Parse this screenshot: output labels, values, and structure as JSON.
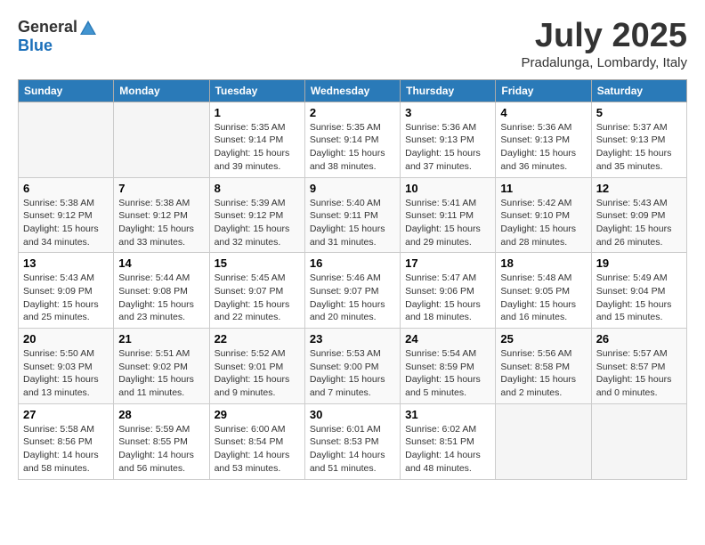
{
  "header": {
    "logo_general": "General",
    "logo_blue": "Blue",
    "month_title": "July 2025",
    "location": "Pradalunga, Lombardy, Italy"
  },
  "days_of_week": [
    "Sunday",
    "Monday",
    "Tuesday",
    "Wednesday",
    "Thursday",
    "Friday",
    "Saturday"
  ],
  "weeks": [
    [
      {
        "num": "",
        "info": ""
      },
      {
        "num": "",
        "info": ""
      },
      {
        "num": "1",
        "info": "Sunrise: 5:35 AM\nSunset: 9:14 PM\nDaylight: 15 hours and 39 minutes."
      },
      {
        "num": "2",
        "info": "Sunrise: 5:35 AM\nSunset: 9:14 PM\nDaylight: 15 hours and 38 minutes."
      },
      {
        "num": "3",
        "info": "Sunrise: 5:36 AM\nSunset: 9:13 PM\nDaylight: 15 hours and 37 minutes."
      },
      {
        "num": "4",
        "info": "Sunrise: 5:36 AM\nSunset: 9:13 PM\nDaylight: 15 hours and 36 minutes."
      },
      {
        "num": "5",
        "info": "Sunrise: 5:37 AM\nSunset: 9:13 PM\nDaylight: 15 hours and 35 minutes."
      }
    ],
    [
      {
        "num": "6",
        "info": "Sunrise: 5:38 AM\nSunset: 9:12 PM\nDaylight: 15 hours and 34 minutes."
      },
      {
        "num": "7",
        "info": "Sunrise: 5:38 AM\nSunset: 9:12 PM\nDaylight: 15 hours and 33 minutes."
      },
      {
        "num": "8",
        "info": "Sunrise: 5:39 AM\nSunset: 9:12 PM\nDaylight: 15 hours and 32 minutes."
      },
      {
        "num": "9",
        "info": "Sunrise: 5:40 AM\nSunset: 9:11 PM\nDaylight: 15 hours and 31 minutes."
      },
      {
        "num": "10",
        "info": "Sunrise: 5:41 AM\nSunset: 9:11 PM\nDaylight: 15 hours and 29 minutes."
      },
      {
        "num": "11",
        "info": "Sunrise: 5:42 AM\nSunset: 9:10 PM\nDaylight: 15 hours and 28 minutes."
      },
      {
        "num": "12",
        "info": "Sunrise: 5:43 AM\nSunset: 9:09 PM\nDaylight: 15 hours and 26 minutes."
      }
    ],
    [
      {
        "num": "13",
        "info": "Sunrise: 5:43 AM\nSunset: 9:09 PM\nDaylight: 15 hours and 25 minutes."
      },
      {
        "num": "14",
        "info": "Sunrise: 5:44 AM\nSunset: 9:08 PM\nDaylight: 15 hours and 23 minutes."
      },
      {
        "num": "15",
        "info": "Sunrise: 5:45 AM\nSunset: 9:07 PM\nDaylight: 15 hours and 22 minutes."
      },
      {
        "num": "16",
        "info": "Sunrise: 5:46 AM\nSunset: 9:07 PM\nDaylight: 15 hours and 20 minutes."
      },
      {
        "num": "17",
        "info": "Sunrise: 5:47 AM\nSunset: 9:06 PM\nDaylight: 15 hours and 18 minutes."
      },
      {
        "num": "18",
        "info": "Sunrise: 5:48 AM\nSunset: 9:05 PM\nDaylight: 15 hours and 16 minutes."
      },
      {
        "num": "19",
        "info": "Sunrise: 5:49 AM\nSunset: 9:04 PM\nDaylight: 15 hours and 15 minutes."
      }
    ],
    [
      {
        "num": "20",
        "info": "Sunrise: 5:50 AM\nSunset: 9:03 PM\nDaylight: 15 hours and 13 minutes."
      },
      {
        "num": "21",
        "info": "Sunrise: 5:51 AM\nSunset: 9:02 PM\nDaylight: 15 hours and 11 minutes."
      },
      {
        "num": "22",
        "info": "Sunrise: 5:52 AM\nSunset: 9:01 PM\nDaylight: 15 hours and 9 minutes."
      },
      {
        "num": "23",
        "info": "Sunrise: 5:53 AM\nSunset: 9:00 PM\nDaylight: 15 hours and 7 minutes."
      },
      {
        "num": "24",
        "info": "Sunrise: 5:54 AM\nSunset: 8:59 PM\nDaylight: 15 hours and 5 minutes."
      },
      {
        "num": "25",
        "info": "Sunrise: 5:56 AM\nSunset: 8:58 PM\nDaylight: 15 hours and 2 minutes."
      },
      {
        "num": "26",
        "info": "Sunrise: 5:57 AM\nSunset: 8:57 PM\nDaylight: 15 hours and 0 minutes."
      }
    ],
    [
      {
        "num": "27",
        "info": "Sunrise: 5:58 AM\nSunset: 8:56 PM\nDaylight: 14 hours and 58 minutes."
      },
      {
        "num": "28",
        "info": "Sunrise: 5:59 AM\nSunset: 8:55 PM\nDaylight: 14 hours and 56 minutes."
      },
      {
        "num": "29",
        "info": "Sunrise: 6:00 AM\nSunset: 8:54 PM\nDaylight: 14 hours and 53 minutes."
      },
      {
        "num": "30",
        "info": "Sunrise: 6:01 AM\nSunset: 8:53 PM\nDaylight: 14 hours and 51 minutes."
      },
      {
        "num": "31",
        "info": "Sunrise: 6:02 AM\nSunset: 8:51 PM\nDaylight: 14 hours and 48 minutes."
      },
      {
        "num": "",
        "info": ""
      },
      {
        "num": "",
        "info": ""
      }
    ]
  ]
}
